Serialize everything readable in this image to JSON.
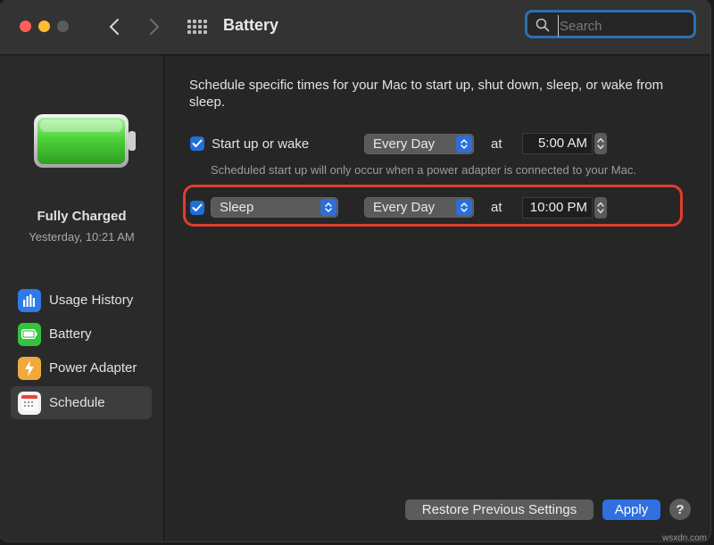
{
  "window": {
    "title": "Battery",
    "search_placeholder": "Search"
  },
  "sidebar": {
    "status_title": "Fully Charged",
    "status_time": "Yesterday, 10:21 AM",
    "items": [
      {
        "label": "Usage History",
        "icon": "bar-chart-icon",
        "active": false
      },
      {
        "label": "Battery",
        "icon": "battery-icon",
        "active": false
      },
      {
        "label": "Power Adapter",
        "icon": "lightning-bolt-icon",
        "active": false
      },
      {
        "label": "Schedule",
        "icon": "calendar-icon",
        "active": true
      }
    ]
  },
  "main": {
    "description": "Schedule specific times for your Mac to start up, shut down, sleep, or wake from sleep.",
    "row1": {
      "checked": true,
      "label": "Start up or wake",
      "frequency": "Every Day",
      "at": "at",
      "time": "5:00 AM"
    },
    "note": "Scheduled start up will only occur when a power adapter is connected to your Mac.",
    "row2": {
      "checked": true,
      "action": "Sleep",
      "frequency": "Every Day",
      "at": "at",
      "time": "10:00 PM"
    },
    "buttons": {
      "restore": "Restore Previous Settings",
      "apply": "Apply",
      "help": "?"
    }
  },
  "watermark": "wsxdn.com",
  "colors": {
    "accent": "#2f6fe0",
    "highlight": "#e23c2e",
    "battery_green": "#4cd137"
  }
}
